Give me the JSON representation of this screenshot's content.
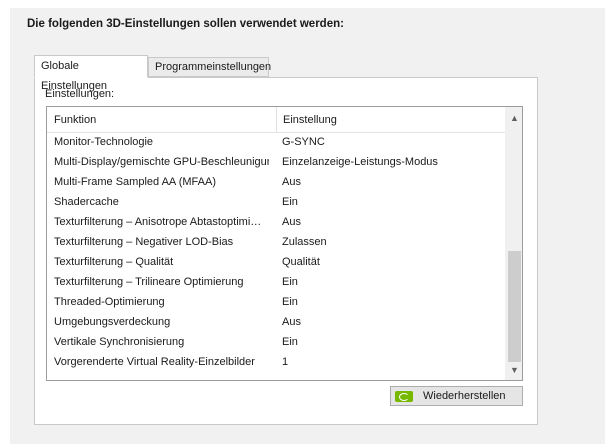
{
  "heading": "Die folgenden 3D-Einstellungen sollen verwendet werden:",
  "tabs": [
    {
      "label": "Globale Einstellungen",
      "active": true
    },
    {
      "label": "Programmeinstellungen",
      "active": false
    }
  ],
  "settings_label": "Einstellungen:",
  "columns": {
    "function": "Funktion",
    "setting": "Einstellung"
  },
  "rows": [
    {
      "function": "Monitor-Technologie",
      "setting": "G-SYNC"
    },
    {
      "function": "Multi-Display/gemischte GPU-Beschleunigung",
      "setting": "Einzelanzeige-Leistungs-Modus"
    },
    {
      "function": "Multi-Frame Sampled AA (MFAA)",
      "setting": "Aus"
    },
    {
      "function": "Shadercache",
      "setting": "Ein"
    },
    {
      "function": "Texturfilterung – Anisotrope Abtastoptimi…",
      "setting": "Aus"
    },
    {
      "function": "Texturfilterung – Negativer LOD-Bias",
      "setting": "Zulassen"
    },
    {
      "function": "Texturfilterung – Qualität",
      "setting": "Qualität"
    },
    {
      "function": "Texturfilterung – Trilineare Optimierung",
      "setting": "Ein"
    },
    {
      "function": "Threaded-Optimierung",
      "setting": "Ein"
    },
    {
      "function": "Umgebungsverdeckung",
      "setting": "Aus"
    },
    {
      "function": "Vertikale Synchronisierung",
      "setting": "Ein"
    },
    {
      "function": "Vorgerenderte Virtual Reality-Einzelbilder",
      "setting": "1"
    }
  ],
  "restore_button": {
    "label": "Wiederherstellen",
    "icon": "nvidia-logo-icon"
  },
  "colors": {
    "nvidia_green": "#76b900",
    "panel_bg": "#f1f1f1"
  }
}
